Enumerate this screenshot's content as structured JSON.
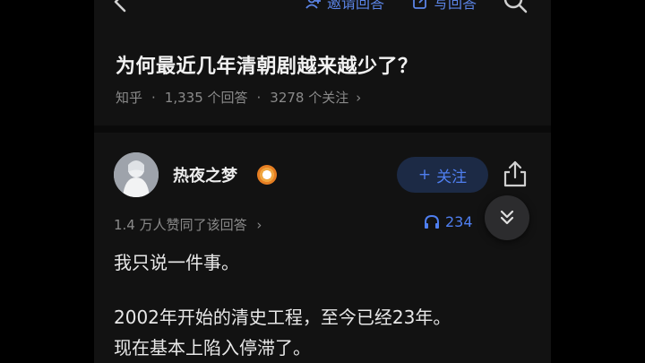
{
  "topbar": {
    "invite_label": "邀请回答",
    "write_label": "写回答"
  },
  "question": {
    "title": "为何最近几年清朝剧越来越少了？",
    "source": "知乎",
    "answers": "1,335 个回答",
    "followers": "3278 个关注",
    "meta_chevron": "›"
  },
  "answer": {
    "author": "热夜之梦",
    "follow_label": "关注",
    "follow_plus": "+",
    "likes": "1.4 万人赞同了该回答",
    "likes_chevron": "›",
    "listen_count": "234",
    "paragraphs": [
      "我只说一件事。",
      "2002年开始的清史工程，至今已经23年。",
      "现在基本上陷入停滞了。"
    ]
  },
  "colors": {
    "accent": "#4f7ff0",
    "background": "#121212",
    "text": "#e8e8e8",
    "muted": "#8a8a8a"
  },
  "icons": [
    "back-arrow-icon",
    "invite-icon",
    "edit-icon",
    "search-icon",
    "verified-badge-icon",
    "share-icon",
    "headphones-icon",
    "chevron-double-down-icon"
  ]
}
